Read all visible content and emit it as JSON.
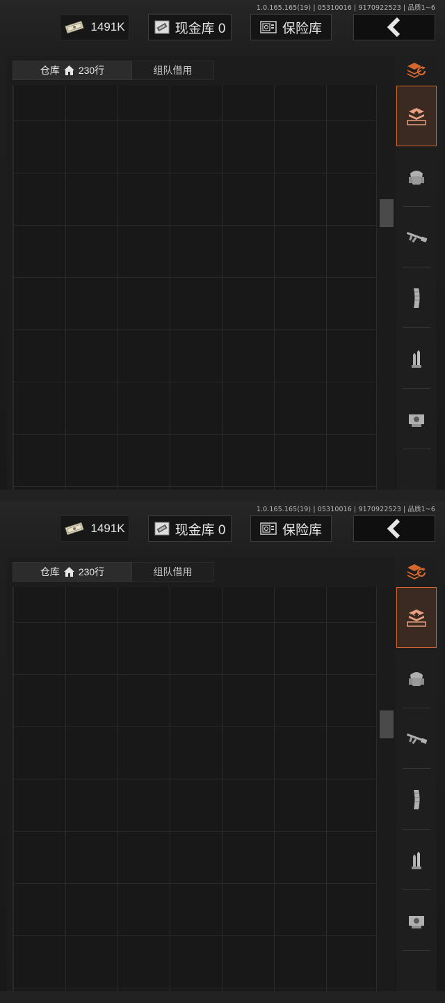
{
  "screens": [
    {
      "version": "1.0.165.165(19) | 05310016 | 9170922523 | 品质1~6",
      "header": {
        "money_value": "1491K",
        "cash_label": "现金库 0",
        "safe_label": "保险库"
      },
      "tabs": {
        "warehouse_label": "仓库",
        "warehouse_rows": "230行",
        "team_label": "组队借用"
      },
      "sidebar": {
        "items": [
          "warehouse-icon",
          "armor-icon",
          "rifle-icon",
          "magazine-icon",
          "ammo-icon",
          "scope-icon"
        ],
        "active_index": 0
      }
    },
    {
      "version": "1.0.165.165(19) | 05310016 | 9170922523 | 品质1~6",
      "header": {
        "money_value": "1491K",
        "cash_label": "现金库 0",
        "safe_label": "保险库"
      },
      "tabs": {
        "warehouse_label": "仓库",
        "warehouse_rows": "230行",
        "team_label": "组队借用"
      },
      "sidebar": {
        "items": [
          "warehouse-icon",
          "armor-icon",
          "rifle-icon",
          "magazine-icon",
          "ammo-icon",
          "scope-icon"
        ],
        "active_index": 0
      }
    }
  ],
  "colors": {
    "accent": "#d4662f",
    "background": "#181818",
    "grid_line": "#2a2a2a"
  }
}
